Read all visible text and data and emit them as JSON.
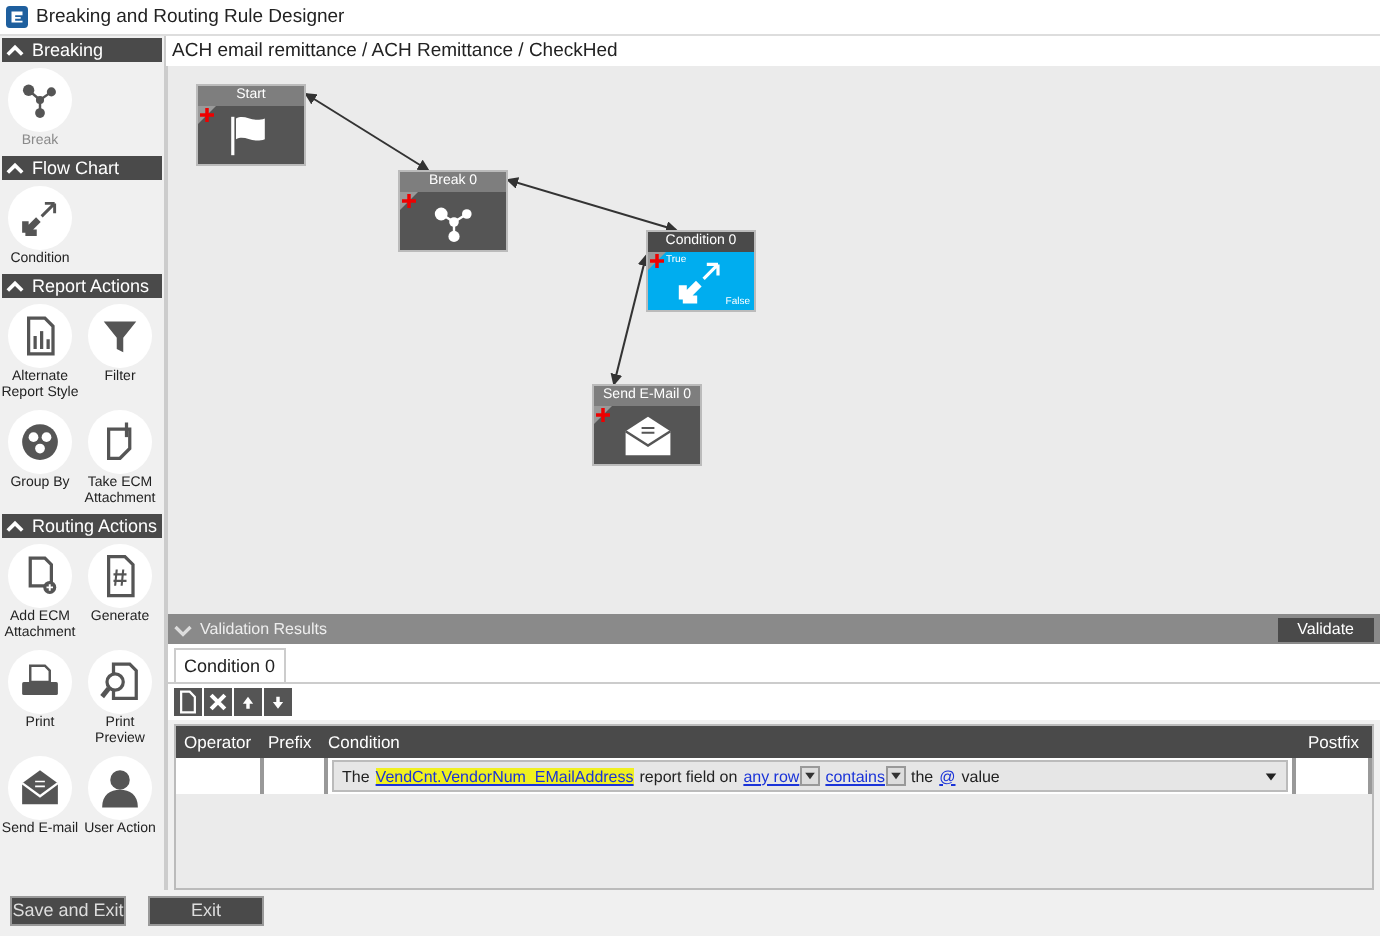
{
  "window": {
    "title": "Breaking and Routing Rule Designer"
  },
  "sidebar": {
    "sections": [
      {
        "title": "Breaking",
        "expanded": true,
        "items": [
          {
            "label": "Break",
            "kind": "break",
            "disabled": true
          }
        ]
      },
      {
        "title": "Flow Chart",
        "expanded": true,
        "items": [
          {
            "label": "Condition",
            "kind": "condition",
            "disabled": false
          }
        ]
      },
      {
        "title": "Report Actions",
        "expanded": true,
        "items": [
          {
            "label": "Alternate Report Style",
            "kind": "report-style",
            "disabled": false
          },
          {
            "label": "Filter",
            "kind": "filter",
            "disabled": false
          },
          {
            "label": "Group By",
            "kind": "group-by",
            "disabled": false
          },
          {
            "label": "Take ECM Attachment",
            "kind": "attachment",
            "disabled": false
          }
        ]
      },
      {
        "title": "Routing Actions",
        "expanded": true,
        "items": [
          {
            "label": "Add ECM Attachment",
            "kind": "add-attachment",
            "disabled": false
          },
          {
            "label": "Generate",
            "kind": "generate",
            "disabled": false
          },
          {
            "label": "Print",
            "kind": "print",
            "disabled": false
          },
          {
            "label": "Print Preview",
            "kind": "preview",
            "disabled": false
          },
          {
            "label": "Send E-mail",
            "kind": "email",
            "disabled": false
          },
          {
            "label": "User Action",
            "kind": "user",
            "disabled": false
          }
        ]
      }
    ]
  },
  "breadcrumb": "ACH email remittance / ACH Remittance / CheckHed",
  "canvas": {
    "nodes": [
      {
        "title": "Start",
        "kind": "start",
        "selected": false
      },
      {
        "title": "Break 0",
        "kind": "break",
        "selected": false
      },
      {
        "title": "Condition 0",
        "kind": "condition",
        "selected": true,
        "true_label": "True",
        "false_label": "False"
      },
      {
        "title": "Send E-Mail 0",
        "kind": "email",
        "selected": false
      }
    ]
  },
  "validation": {
    "title": "Validation Results",
    "expanded": false,
    "button": "Validate"
  },
  "tabs": [
    {
      "label": "Condition 0",
      "selected": true
    }
  ],
  "table": {
    "columns": [
      "Operator",
      "Prefix",
      "Condition",
      "Postfix"
    ],
    "rows": [
      {
        "operator": "",
        "prefix": "",
        "condition": [
          {
            "kind": "text",
            "text": "The"
          },
          {
            "kind": "field",
            "text": "VendCnt.VendorNum_EMailAddress",
            "highlighted": true
          },
          {
            "kind": "text",
            "text": "report field on"
          },
          {
            "kind": "choice",
            "text": "any row"
          },
          {
            "kind": "choice",
            "text": "contains"
          },
          {
            "kind": "text",
            "text": "the"
          },
          {
            "kind": "field",
            "text": "@",
            "highlighted": false
          },
          {
            "kind": "text",
            "text": "value"
          }
        ],
        "postfix": ""
      }
    ]
  },
  "buttons": [
    {
      "label": "Save and Exit"
    },
    {
      "label": "Exit"
    }
  ]
}
